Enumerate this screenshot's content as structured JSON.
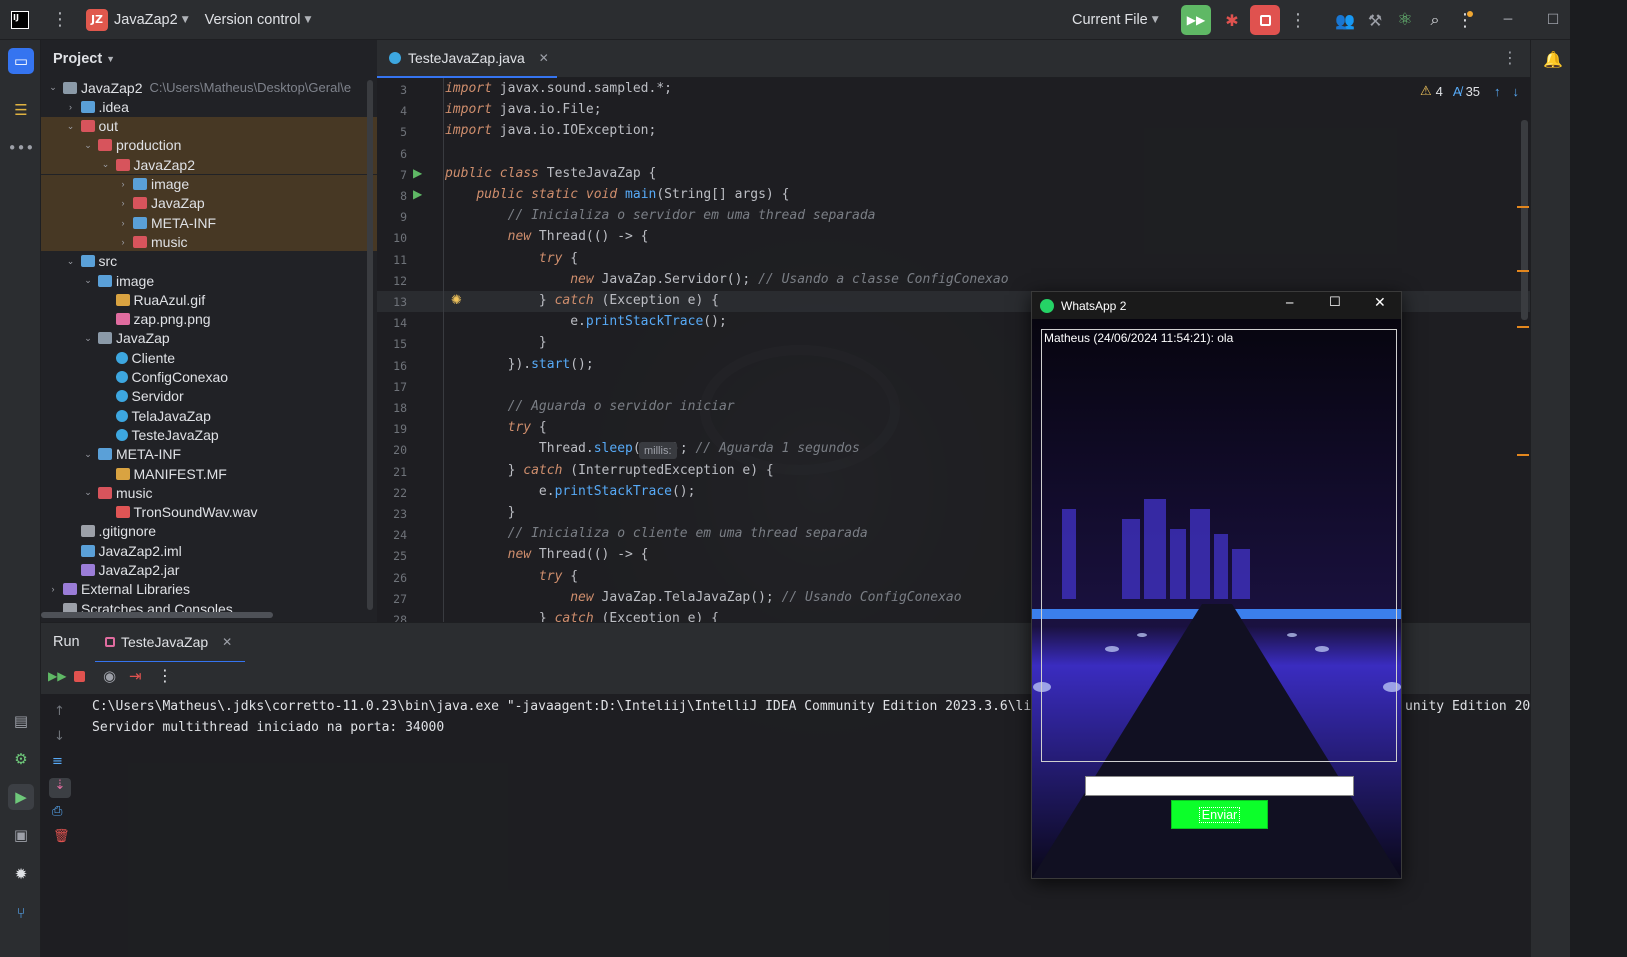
{
  "titlebar": {
    "project_badge": "JZ",
    "project_name": "JavaZap2",
    "vcs_label": "Version control",
    "run_config": "Current File"
  },
  "project_panel": {
    "title": "Project",
    "tree": [
      {
        "label": "JavaZap2",
        "extra": "C:\\Users\\Matheus\\Desktop\\Geral\\e",
        "arrow": "⌄",
        "icon": "module-folder-icon"
      },
      {
        "label": ".idea",
        "arrow": "›",
        "icon": "folder-icon"
      },
      {
        "label": "out",
        "arrow": "⌄",
        "icon": "excluded-folder-icon"
      },
      {
        "label": "production",
        "arrow": "⌄",
        "icon": "excluded-folder-icon"
      },
      {
        "label": "JavaZap2",
        "arrow": "⌄",
        "icon": "excluded-folder-icon"
      },
      {
        "label": "image",
        "arrow": "›",
        "icon": "resource-folder-icon"
      },
      {
        "label": "JavaZap",
        "arrow": "›",
        "icon": "excluded-folder-icon"
      },
      {
        "label": "META-INF",
        "arrow": "›",
        "icon": "blue-folder-icon"
      },
      {
        "label": "music",
        "arrow": "›",
        "icon": "audio-folder-icon"
      },
      {
        "label": "src",
        "arrow": "⌄",
        "icon": "source-folder-icon"
      },
      {
        "label": "image",
        "arrow": "⌄",
        "icon": "resource-folder-icon"
      },
      {
        "label": "RuaAzul.gif",
        "arrow": "",
        "icon": "gif-file-icon"
      },
      {
        "label": "zap.png.png",
        "arrow": "",
        "icon": "image-file-icon"
      },
      {
        "label": "JavaZap",
        "arrow": "⌄",
        "icon": "package-folder-icon"
      },
      {
        "label": "Cliente",
        "arrow": "",
        "icon": "java-class-icon"
      },
      {
        "label": "ConfigConexao",
        "arrow": "",
        "icon": "java-class-icon"
      },
      {
        "label": "Servidor",
        "arrow": "",
        "icon": "java-class-icon"
      },
      {
        "label": "TelaJavaZap",
        "arrow": "",
        "icon": "java-class-icon"
      },
      {
        "label": "TesteJavaZap",
        "arrow": "",
        "icon": "java-class-icon"
      },
      {
        "label": "META-INF",
        "arrow": "⌄",
        "icon": "blue-folder-icon"
      },
      {
        "label": "MANIFEST.MF",
        "arrow": "",
        "icon": "manifest-file-icon"
      },
      {
        "label": "music",
        "arrow": "⌄",
        "icon": "audio-folder-icon"
      },
      {
        "label": "TronSoundWav.wav",
        "arrow": "",
        "icon": "audio-file-icon"
      },
      {
        "label": ".gitignore",
        "arrow": "",
        "icon": "gitignore-file-icon"
      },
      {
        "label": "JavaZap2.iml",
        "arrow": "",
        "icon": "iml-file-icon"
      },
      {
        "label": "JavaZap2.jar",
        "arrow": "",
        "icon": "jar-file-icon"
      },
      {
        "label": "External Libraries",
        "arrow": "›",
        "icon": "library-icon"
      },
      {
        "label": "Scratches and Consoles",
        "arrow": "",
        "icon": "scratches-icon"
      }
    ]
  },
  "editor": {
    "tab_label": "TesteJavaZap.java",
    "warnings": "4",
    "typos": "35",
    "param_hint": "millis:"
  },
  "code": [
    {
      "n": "3",
      "t": "import javax.sound.sampled.*;"
    },
    {
      "n": "4",
      "t": "import java.io.File;"
    },
    {
      "n": "5",
      "t": "import java.io.IOException;"
    },
    {
      "n": "6",
      "t": ""
    },
    {
      "n": "7",
      "t": "public class TesteJavaZap {"
    },
    {
      "n": "8",
      "t": "    public static void main(String[] args) {"
    },
    {
      "n": "9",
      "t": "        // Inicializa o servidor em uma thread separada"
    },
    {
      "n": "10",
      "t": "        new Thread(() -> {"
    },
    {
      "n": "11",
      "t": "            try {"
    },
    {
      "n": "12",
      "t": "                new JavaZap.Servidor(); // Usando a classe ConfigConexao"
    },
    {
      "n": "13",
      "t": "            } catch (Exception e) {"
    },
    {
      "n": "14",
      "t": "                e.printStackTrace();"
    },
    {
      "n": "15",
      "t": "            }"
    },
    {
      "n": "16",
      "t": "        }).start();"
    },
    {
      "n": "17",
      "t": ""
    },
    {
      "n": "18",
      "t": "        // Aguarda o servidor iniciar"
    },
    {
      "n": "19",
      "t": "        try {"
    },
    {
      "n": "20",
      "t": "            Thread.sleep(1000); // Aguarda 1 segundos"
    },
    {
      "n": "21",
      "t": "        } catch (InterruptedException e) {"
    },
    {
      "n": "22",
      "t": "            e.printStackTrace();"
    },
    {
      "n": "23",
      "t": "        }"
    },
    {
      "n": "24",
      "t": "        // Inicializa o cliente em uma thread separada"
    },
    {
      "n": "25",
      "t": "        new Thread(() -> {"
    },
    {
      "n": "26",
      "t": "            try {"
    },
    {
      "n": "27",
      "t": "                new JavaZap.TelaJavaZap(); // Usando ConfigConexao"
    },
    {
      "n": "28",
      "t": "            } catch (Exception e) {"
    }
  ],
  "run_panel": {
    "title": "Run",
    "tab_label": "TesteJavaZap",
    "console": [
      "C:\\Users\\Matheus\\.jdks\\corretto-11.0.23\\bin\\java.exe \"-javaagent:D:\\Inteliij\\IntelliJ IDEA Community Edition 2023.3.6\\lib\\",
      "Servidor multithread iniciado na porta: 34000"
    ],
    "console_tail": "unity Edition 202"
  },
  "whatsapp": {
    "title": "WhatsApp 2",
    "message": "Matheus (24/06/2024 11:54:21): ola",
    "input_value": "",
    "send_label": "Enviar"
  },
  "colors": {
    "accent": "#3574f0",
    "send_button": "#0cff2a",
    "run_green": "#5fb865",
    "stop_red": "#e0524f"
  }
}
